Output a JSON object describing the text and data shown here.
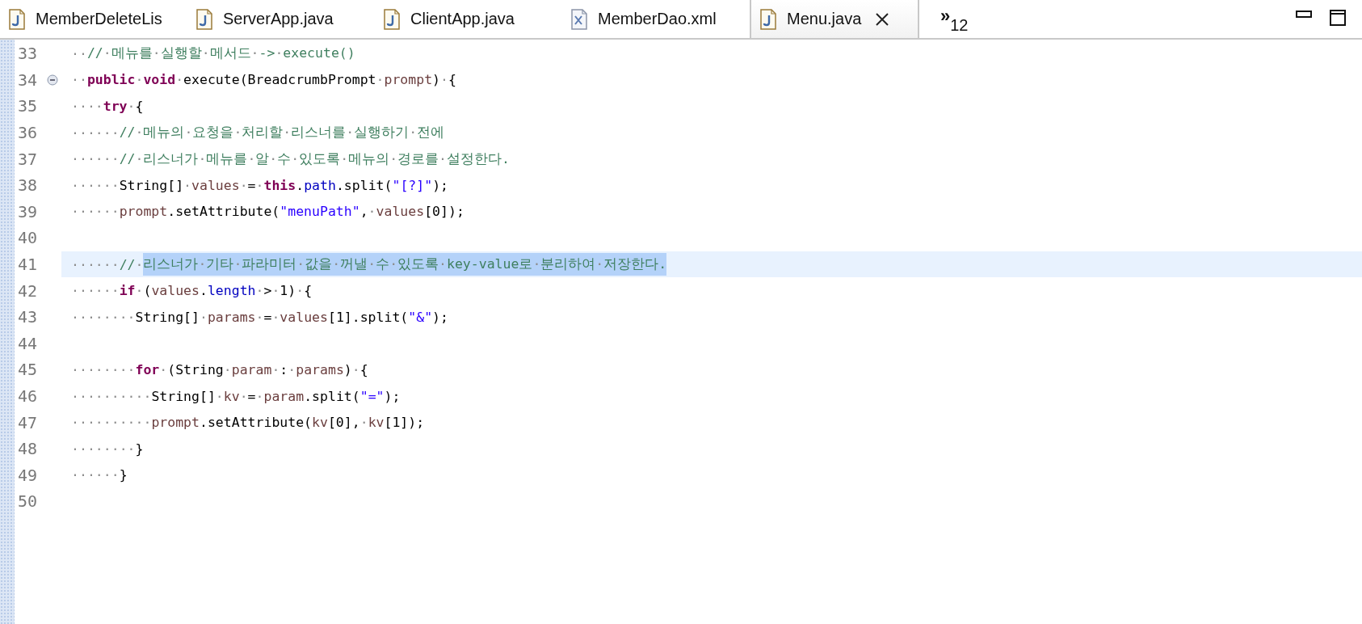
{
  "tabs": [
    {
      "label": "MemberDeleteLis",
      "kind": "java",
      "selected": false
    },
    {
      "label": "ServerApp.java",
      "kind": "java",
      "selected": false
    },
    {
      "label": "ClientApp.java",
      "kind": "java",
      "selected": false
    },
    {
      "label": "MemberDao.xml",
      "kind": "xml",
      "selected": false
    },
    {
      "label": "Menu.java",
      "kind": "java",
      "selected": true
    }
  ],
  "overflow": {
    "marker": "»",
    "count": "12"
  },
  "editor": {
    "lines": [
      {
        "number": "33",
        "current": false,
        "tokens": [
          {
            "kind": "plain",
            "text": "··"
          },
          {
            "kind": "comment",
            "text": "//·메뉴를·실행할·메서드·->·execute()"
          }
        ]
      },
      {
        "number": "34",
        "current": false,
        "expanded": true,
        "tokens": [
          {
            "kind": "plain",
            "text": "··"
          },
          {
            "kind": "keyword",
            "text": "public"
          },
          {
            "kind": "plain",
            "text": "·"
          },
          {
            "kind": "keyword",
            "text": "void"
          },
          {
            "kind": "plain",
            "text": "·execute(BreadcrumbPrompt·"
          },
          {
            "kind": "variable",
            "text": "prompt"
          },
          {
            "kind": "plain",
            "text": ")·{"
          }
        ]
      },
      {
        "number": "35",
        "current": false,
        "tokens": [
          {
            "kind": "plain",
            "text": "····"
          },
          {
            "kind": "keyword",
            "text": "try"
          },
          {
            "kind": "plain",
            "text": "·{"
          }
        ]
      },
      {
        "number": "36",
        "current": false,
        "tokens": [
          {
            "kind": "plain",
            "text": "······"
          },
          {
            "kind": "comment",
            "text": "//·메뉴의·요청을·처리할·리스너를·실행하기·전에"
          }
        ]
      },
      {
        "number": "37",
        "current": false,
        "tokens": [
          {
            "kind": "plain",
            "text": "······"
          },
          {
            "kind": "comment",
            "text": "//·리스너가·메뉴를·알·수·있도록·메뉴의·경로를·설정한다."
          }
        ]
      },
      {
        "number": "38",
        "current": false,
        "tokens": [
          {
            "kind": "plain",
            "text": "······String[]·"
          },
          {
            "kind": "variable",
            "text": "values"
          },
          {
            "kind": "plain",
            "text": "·=·"
          },
          {
            "kind": "keyword",
            "text": "this"
          },
          {
            "kind": "plain",
            "text": "."
          },
          {
            "kind": "field",
            "text": "path"
          },
          {
            "kind": "plain",
            "text": ".split("
          },
          {
            "kind": "string",
            "text": "\"[?]\""
          },
          {
            "kind": "plain",
            "text": ");"
          }
        ]
      },
      {
        "number": "39",
        "current": false,
        "tokens": [
          {
            "kind": "plain",
            "text": "······"
          },
          {
            "kind": "variable",
            "text": "prompt"
          },
          {
            "kind": "plain",
            "text": ".setAttribute("
          },
          {
            "kind": "string",
            "text": "\"menuPath\""
          },
          {
            "kind": "plain",
            "text": ",·"
          },
          {
            "kind": "variable",
            "text": "values"
          },
          {
            "kind": "plain",
            "text": "[0]);"
          }
        ]
      },
      {
        "number": "40",
        "current": false
      },
      {
        "number": "41",
        "current": true,
        "tokens": [
          {
            "kind": "plain",
            "text": "······"
          },
          {
            "kind": "comment",
            "text": "//·"
          },
          {
            "kind": "selection",
            "text": "리스너가·기타·파라미터·값을·꺼낼·수·있도록·key-value로·분리하여·저장한다."
          }
        ]
      },
      {
        "number": "42",
        "current": false,
        "tokens": [
          {
            "kind": "plain",
            "text": "······"
          },
          {
            "kind": "keyword",
            "text": "if"
          },
          {
            "kind": "plain",
            "text": "·("
          },
          {
            "kind": "variable",
            "text": "values"
          },
          {
            "kind": "plain",
            "text": "."
          },
          {
            "kind": "field",
            "text": "length"
          },
          {
            "kind": "plain",
            "text": "·>·1)·{"
          }
        ]
      },
      {
        "number": "43",
        "current": false,
        "tokens": [
          {
            "kind": "plain",
            "text": "········String[]·"
          },
          {
            "kind": "variable",
            "text": "params"
          },
          {
            "kind": "plain",
            "text": "·=·"
          },
          {
            "kind": "variable",
            "text": "values"
          },
          {
            "kind": "plain",
            "text": "[1].split("
          },
          {
            "kind": "string",
            "text": "\"&\""
          },
          {
            "kind": "plain",
            "text": ");"
          }
        ]
      },
      {
        "number": "44",
        "current": false
      },
      {
        "number": "45",
        "current": false,
        "tokens": [
          {
            "kind": "plain",
            "text": "········"
          },
          {
            "kind": "keyword",
            "text": "for"
          },
          {
            "kind": "plain",
            "text": "·(String·"
          },
          {
            "kind": "variable",
            "text": "param"
          },
          {
            "kind": "plain",
            "text": "·:·"
          },
          {
            "kind": "variable",
            "text": "params"
          },
          {
            "kind": "plain",
            "text": ")·{"
          }
        ]
      },
      {
        "number": "46",
        "current": false,
        "tokens": [
          {
            "kind": "plain",
            "text": "··········String[]·"
          },
          {
            "kind": "variable",
            "text": "kv"
          },
          {
            "kind": "plain",
            "text": "·=·"
          },
          {
            "kind": "variable",
            "text": "param"
          },
          {
            "kind": "plain",
            "text": ".split("
          },
          {
            "kind": "string",
            "text": "\"=\""
          },
          {
            "kind": "plain",
            "text": ");"
          }
        ]
      },
      {
        "number": "47",
        "current": false,
        "tokens": [
          {
            "kind": "plain",
            "text": "··········"
          },
          {
            "kind": "variable",
            "text": "prompt"
          },
          {
            "kind": "plain",
            "text": ".setAttribute("
          },
          {
            "kind": "variable",
            "text": "kv"
          },
          {
            "kind": "plain",
            "text": "[0],·"
          },
          {
            "kind": "variable",
            "text": "kv"
          },
          {
            "kind": "plain",
            "text": "[1]);"
          }
        ]
      },
      {
        "number": "48",
        "current": false,
        "tokens": [
          {
            "kind": "plain",
            "text": "········}"
          }
        ]
      },
      {
        "number": "49",
        "current": false,
        "tokens": [
          {
            "kind": "plain",
            "text": "······}"
          }
        ]
      },
      {
        "number": "50",
        "current": false
      }
    ]
  }
}
